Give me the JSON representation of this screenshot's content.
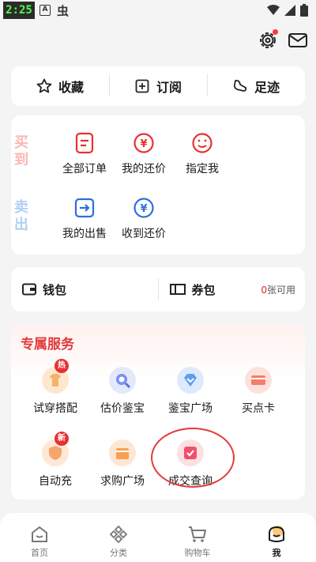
{
  "status_bar": {
    "time": "2:25",
    "app_a": "A",
    "app_bug": "虫"
  },
  "top_row": [
    {
      "label": "收藏",
      "icon": "star-icon"
    },
    {
      "label": "订阅",
      "icon": "subscribe-icon"
    },
    {
      "label": "足迹",
      "icon": "footprint-icon"
    }
  ],
  "orders": {
    "buy_label": "买到",
    "sell_label": "卖出",
    "buy_items": [
      {
        "label": "全部订单",
        "icon": "all-orders-icon"
      },
      {
        "label": "我的还价",
        "icon": "my-counteroffer-icon"
      },
      {
        "label": "指定我",
        "icon": "designated-me-icon"
      }
    ],
    "sell_items": [
      {
        "label": "我的出售",
        "icon": "my-sales-icon"
      },
      {
        "label": "收到还价",
        "icon": "received-counteroffer-icon"
      }
    ]
  },
  "wallet": {
    "wallet_label": "钱包",
    "coupon_label": "券包",
    "coupon_count": "0",
    "coupon_suffix": "张可用"
  },
  "services": {
    "title": "专属服务",
    "items": [
      {
        "label": "试穿搭配",
        "badge": "热",
        "icon": "try-on-icon"
      },
      {
        "label": "估价鉴宝",
        "icon": "appraisal-icon"
      },
      {
        "label": "鉴宝广场",
        "icon": "appraisal-square-icon"
      },
      {
        "label": "买点卡",
        "icon": "buy-card-icon"
      },
      {
        "label": "自动充",
        "badge": "新",
        "icon": "auto-recharge-icon"
      },
      {
        "label": "求购广场",
        "icon": "wanted-square-icon"
      },
      {
        "label": "成交查询",
        "icon": "deal-query-icon"
      }
    ]
  },
  "bottom_nav": [
    {
      "label": "首页",
      "icon": "home-icon"
    },
    {
      "label": "分类",
      "icon": "category-icon"
    },
    {
      "label": "购物车",
      "icon": "cart-icon"
    },
    {
      "label": "我",
      "icon": "me-icon",
      "active": true
    }
  ],
  "colors": {
    "accent_red": "#e33b3b",
    "buy_label": "#f9b7b3",
    "sell_label": "#b3cff5",
    "order_icon_red": "#e83030",
    "order_icon_blue": "#2b6fe0"
  }
}
